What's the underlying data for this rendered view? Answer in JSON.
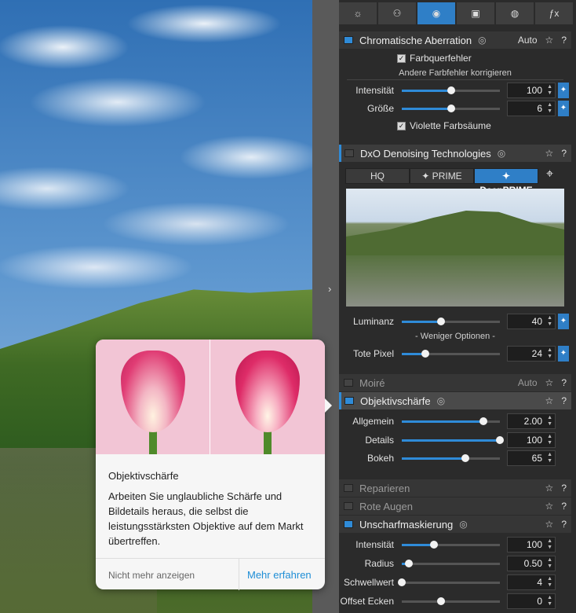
{
  "tabs": [
    {
      "icon": "light-icon",
      "glyph": "☼"
    },
    {
      "icon": "color-icon",
      "glyph": "⚇"
    },
    {
      "icon": "detail-icon",
      "glyph": "◉"
    },
    {
      "icon": "geometry-icon",
      "glyph": "▣"
    },
    {
      "icon": "local-adjust-icon",
      "glyph": "◍"
    },
    {
      "icon": "effects-icon",
      "glyph": "ƒx"
    }
  ],
  "ca": {
    "title": "Chromatische Aberration",
    "auto": "Auto",
    "check1": "Farbquerfehler",
    "other": "Andere Farbfehler korrigieren",
    "intensity": {
      "label": "Intensität",
      "value": "100",
      "frac": 0.5
    },
    "size": {
      "label": "Größe",
      "value": "6",
      "frac": 0.5
    },
    "check2": "Violette Farbsäume"
  },
  "denoise": {
    "title": "DxO Denoising Technologies",
    "modes": [
      "HQ",
      "✦ PRIME",
      "✦ DeepPRIME"
    ],
    "luminance": {
      "label": "Luminanz",
      "value": "40",
      "frac": 0.4
    },
    "fewer": "- Weniger Optionen -",
    "deadpixel": {
      "label": "Tote Pixel",
      "value": "24",
      "frac": 0.24
    }
  },
  "moire": {
    "title": "Moiré",
    "auto": "Auto"
  },
  "sharp": {
    "title": "Objektivschärfe",
    "general": {
      "label": "Allgemein",
      "value": "2.00",
      "frac": 0.83
    },
    "details": {
      "label": "Details",
      "value": "100",
      "frac": 1.0
    },
    "bokeh": {
      "label": "Bokeh",
      "value": "65",
      "frac": 0.65
    }
  },
  "repair": {
    "title": "Reparieren"
  },
  "redeye": {
    "title": "Rote Augen"
  },
  "unsharp": {
    "title": "Unscharfmaskierung",
    "intensity": {
      "label": "Intensität",
      "value": "100",
      "frac": 0.33
    },
    "radius": {
      "label": "Radius",
      "value": "0.50",
      "frac": 0.07
    },
    "threshold": {
      "label": "Schwellwert",
      "value": "4",
      "frac": 0.0
    },
    "offset": {
      "label": "Offset Ecken",
      "value": "0",
      "frac": 0.4
    }
  },
  "popup": {
    "title": "Objektivschärfe",
    "body": "Arbeiten Sie unglaubliche Schärfe und Bildetails heraus, die selbst die leistungsstärksten Objektive auf dem Markt übertreffen.",
    "nomore": "Nicht mehr anzeigen",
    "more": "Mehr erfahren"
  },
  "icons": {
    "star": "☆",
    "help": "?",
    "eye": "👁",
    "wand": "✎",
    "spin_up": "▲",
    "spin_down": "▼",
    "chevron": "›",
    "target": "⌖",
    "check": "✓"
  },
  "colors": {
    "accent": "#2f8bd8",
    "panel": "#2b2b2b",
    "link": "#1f8ed6"
  }
}
